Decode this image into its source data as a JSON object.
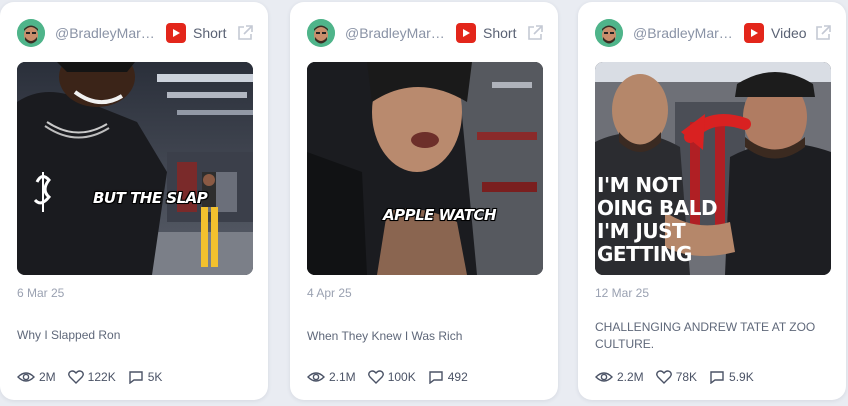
{
  "cards": [
    {
      "handle": "@BradleyMart...",
      "platform_icon": "youtube-icon",
      "type": "Short",
      "thumbnail_caption": "BUT THE SLAP",
      "date": "6 Mar 25",
      "title": "Why I Slapped Ron",
      "views": "2M",
      "likes": "122K",
      "comments": "5K"
    },
    {
      "handle": "@BradleyMart...",
      "platform_icon": "youtube-icon",
      "type": "Short",
      "thumbnail_caption": "APPLE WATCH",
      "date": "4 Apr 25",
      "title": "When They Knew I Was Rich",
      "views": "2.1M",
      "likes": "100K",
      "comments": "492"
    },
    {
      "handle": "@BradleyMart...",
      "platform_icon": "youtube-icon",
      "type": "Video",
      "thumbnail_caption": "I'M NOT\nOING BALD\nI'M JUST\nGETTING",
      "date": "12 Mar 25",
      "title": "CHALLENGING ANDREW TATE AT ZOO CULTURE.",
      "views": "2.2M",
      "likes": "78K",
      "comments": "5.9K"
    }
  ],
  "colors": {
    "background": "#e9ecf2",
    "card": "#ffffff",
    "youtube_red": "#e3261b",
    "avatar": "#4fb48a",
    "muted_text": "#9aa1b1"
  }
}
